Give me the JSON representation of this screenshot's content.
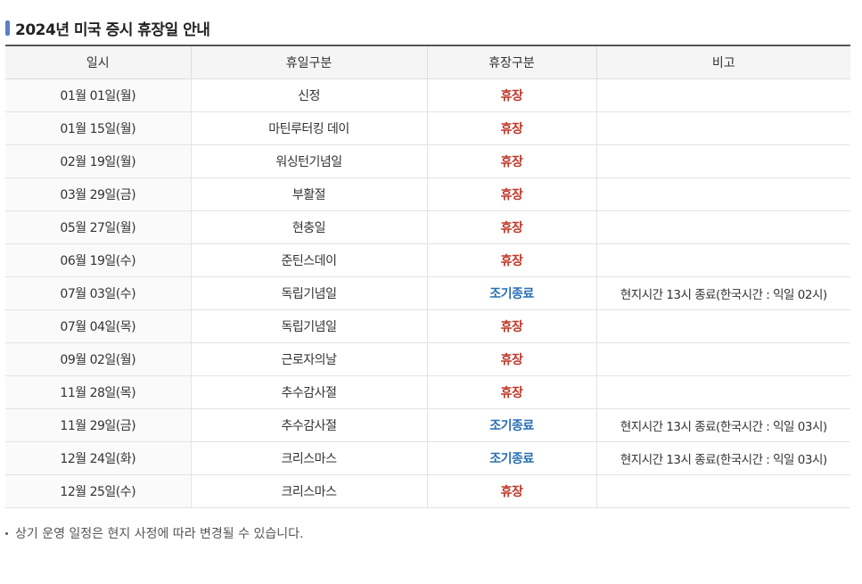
{
  "title": "2024년 미국 증시 휴장일 안내",
  "table": {
    "headers": [
      "일시",
      "휴일구분",
      "휴장구분",
      "비고"
    ],
    "rows": [
      {
        "date": "01월 01일(월)",
        "holiday": "신정",
        "type": "휴장",
        "kind": "closed",
        "note": ""
      },
      {
        "date": "01월 15일(월)",
        "holiday": "마틴루터킹 데이",
        "type": "휴장",
        "kind": "closed",
        "note": ""
      },
      {
        "date": "02월 19일(월)",
        "holiday": "워싱턴기념일",
        "type": "휴장",
        "kind": "closed",
        "note": ""
      },
      {
        "date": "03월 29일(금)",
        "holiday": "부활절",
        "type": "휴장",
        "kind": "closed",
        "note": ""
      },
      {
        "date": "05월 27일(월)",
        "holiday": "현충일",
        "type": "휴장",
        "kind": "closed",
        "note": ""
      },
      {
        "date": "06월 19일(수)",
        "holiday": "준틴스데이",
        "type": "휴장",
        "kind": "closed",
        "note": ""
      },
      {
        "date": "07월 03일(수)",
        "holiday": "독립기념일",
        "type": "조기종료",
        "kind": "early",
        "note": "현지시간 13시 종료(한국시간 : 익일 02시)"
      },
      {
        "date": "07월 04일(목)",
        "holiday": "독립기념일",
        "type": "휴장",
        "kind": "closed",
        "note": ""
      },
      {
        "date": "09월 02일(월)",
        "holiday": "근로자의날",
        "type": "휴장",
        "kind": "closed",
        "note": ""
      },
      {
        "date": "11월 28일(목)",
        "holiday": "추수감사절",
        "type": "휴장",
        "kind": "closed",
        "note": ""
      },
      {
        "date": "11월 29일(금)",
        "holiday": "추수감사절",
        "type": "조기종료",
        "kind": "early",
        "note": "현지시간 13시 종료(한국시간 : 익일 03시)"
      },
      {
        "date": "12월 24일(화)",
        "holiday": "크리스마스",
        "type": "조기종료",
        "kind": "early",
        "note": "현지시간 13시 종료(한국시간 : 익일 03시)"
      },
      {
        "date": "12월 25일(수)",
        "holiday": "크리스마스",
        "type": "휴장",
        "kind": "closed",
        "note": ""
      }
    ]
  },
  "footnote": "상기 운영 일정은 현지 사정에 따라 변경될 수 있습니다.",
  "colors": {
    "closed": "#c0392b",
    "early": "#2a6fb4",
    "marker": "#5b7fc7"
  }
}
